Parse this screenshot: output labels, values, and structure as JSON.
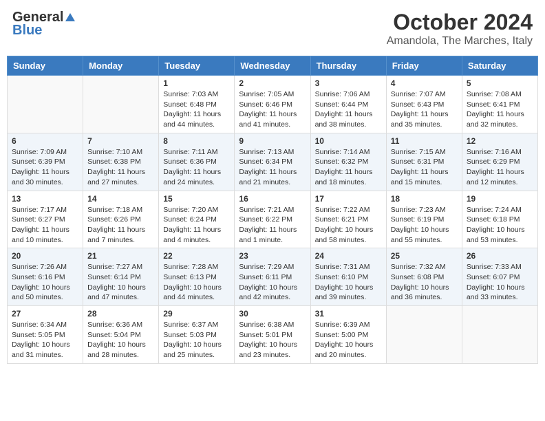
{
  "header": {
    "logo_general": "General",
    "logo_blue": "Blue",
    "month": "October 2024",
    "location": "Amandola, The Marches, Italy"
  },
  "weekdays": [
    "Sunday",
    "Monday",
    "Tuesday",
    "Wednesday",
    "Thursday",
    "Friday",
    "Saturday"
  ],
  "weeks": [
    [
      {
        "day": "",
        "sunrise": "",
        "sunset": "",
        "daylight": ""
      },
      {
        "day": "",
        "sunrise": "",
        "sunset": "",
        "daylight": ""
      },
      {
        "day": "1",
        "sunrise": "Sunrise: 7:03 AM",
        "sunset": "Sunset: 6:48 PM",
        "daylight": "Daylight: 11 hours and 44 minutes."
      },
      {
        "day": "2",
        "sunrise": "Sunrise: 7:05 AM",
        "sunset": "Sunset: 6:46 PM",
        "daylight": "Daylight: 11 hours and 41 minutes."
      },
      {
        "day": "3",
        "sunrise": "Sunrise: 7:06 AM",
        "sunset": "Sunset: 6:44 PM",
        "daylight": "Daylight: 11 hours and 38 minutes."
      },
      {
        "day": "4",
        "sunrise": "Sunrise: 7:07 AM",
        "sunset": "Sunset: 6:43 PM",
        "daylight": "Daylight: 11 hours and 35 minutes."
      },
      {
        "day": "5",
        "sunrise": "Sunrise: 7:08 AM",
        "sunset": "Sunset: 6:41 PM",
        "daylight": "Daylight: 11 hours and 32 minutes."
      }
    ],
    [
      {
        "day": "6",
        "sunrise": "Sunrise: 7:09 AM",
        "sunset": "Sunset: 6:39 PM",
        "daylight": "Daylight: 11 hours and 30 minutes."
      },
      {
        "day": "7",
        "sunrise": "Sunrise: 7:10 AM",
        "sunset": "Sunset: 6:38 PM",
        "daylight": "Daylight: 11 hours and 27 minutes."
      },
      {
        "day": "8",
        "sunrise": "Sunrise: 7:11 AM",
        "sunset": "Sunset: 6:36 PM",
        "daylight": "Daylight: 11 hours and 24 minutes."
      },
      {
        "day": "9",
        "sunrise": "Sunrise: 7:13 AM",
        "sunset": "Sunset: 6:34 PM",
        "daylight": "Daylight: 11 hours and 21 minutes."
      },
      {
        "day": "10",
        "sunrise": "Sunrise: 7:14 AM",
        "sunset": "Sunset: 6:32 PM",
        "daylight": "Daylight: 11 hours and 18 minutes."
      },
      {
        "day": "11",
        "sunrise": "Sunrise: 7:15 AM",
        "sunset": "Sunset: 6:31 PM",
        "daylight": "Daylight: 11 hours and 15 minutes."
      },
      {
        "day": "12",
        "sunrise": "Sunrise: 7:16 AM",
        "sunset": "Sunset: 6:29 PM",
        "daylight": "Daylight: 11 hours and 12 minutes."
      }
    ],
    [
      {
        "day": "13",
        "sunrise": "Sunrise: 7:17 AM",
        "sunset": "Sunset: 6:27 PM",
        "daylight": "Daylight: 11 hours and 10 minutes."
      },
      {
        "day": "14",
        "sunrise": "Sunrise: 7:18 AM",
        "sunset": "Sunset: 6:26 PM",
        "daylight": "Daylight: 11 hours and 7 minutes."
      },
      {
        "day": "15",
        "sunrise": "Sunrise: 7:20 AM",
        "sunset": "Sunset: 6:24 PM",
        "daylight": "Daylight: 11 hours and 4 minutes."
      },
      {
        "day": "16",
        "sunrise": "Sunrise: 7:21 AM",
        "sunset": "Sunset: 6:22 PM",
        "daylight": "Daylight: 11 hours and 1 minute."
      },
      {
        "day": "17",
        "sunrise": "Sunrise: 7:22 AM",
        "sunset": "Sunset: 6:21 PM",
        "daylight": "Daylight: 10 hours and 58 minutes."
      },
      {
        "day": "18",
        "sunrise": "Sunrise: 7:23 AM",
        "sunset": "Sunset: 6:19 PM",
        "daylight": "Daylight: 10 hours and 55 minutes."
      },
      {
        "day": "19",
        "sunrise": "Sunrise: 7:24 AM",
        "sunset": "Sunset: 6:18 PM",
        "daylight": "Daylight: 10 hours and 53 minutes."
      }
    ],
    [
      {
        "day": "20",
        "sunrise": "Sunrise: 7:26 AM",
        "sunset": "Sunset: 6:16 PM",
        "daylight": "Daylight: 10 hours and 50 minutes."
      },
      {
        "day": "21",
        "sunrise": "Sunrise: 7:27 AM",
        "sunset": "Sunset: 6:14 PM",
        "daylight": "Daylight: 10 hours and 47 minutes."
      },
      {
        "day": "22",
        "sunrise": "Sunrise: 7:28 AM",
        "sunset": "Sunset: 6:13 PM",
        "daylight": "Daylight: 10 hours and 44 minutes."
      },
      {
        "day": "23",
        "sunrise": "Sunrise: 7:29 AM",
        "sunset": "Sunset: 6:11 PM",
        "daylight": "Daylight: 10 hours and 42 minutes."
      },
      {
        "day": "24",
        "sunrise": "Sunrise: 7:31 AM",
        "sunset": "Sunset: 6:10 PM",
        "daylight": "Daylight: 10 hours and 39 minutes."
      },
      {
        "day": "25",
        "sunrise": "Sunrise: 7:32 AM",
        "sunset": "Sunset: 6:08 PM",
        "daylight": "Daylight: 10 hours and 36 minutes."
      },
      {
        "day": "26",
        "sunrise": "Sunrise: 7:33 AM",
        "sunset": "Sunset: 6:07 PM",
        "daylight": "Daylight: 10 hours and 33 minutes."
      }
    ],
    [
      {
        "day": "27",
        "sunrise": "Sunrise: 6:34 AM",
        "sunset": "Sunset: 5:05 PM",
        "daylight": "Daylight: 10 hours and 31 minutes."
      },
      {
        "day": "28",
        "sunrise": "Sunrise: 6:36 AM",
        "sunset": "Sunset: 5:04 PM",
        "daylight": "Daylight: 10 hours and 28 minutes."
      },
      {
        "day": "29",
        "sunrise": "Sunrise: 6:37 AM",
        "sunset": "Sunset: 5:03 PM",
        "daylight": "Daylight: 10 hours and 25 minutes."
      },
      {
        "day": "30",
        "sunrise": "Sunrise: 6:38 AM",
        "sunset": "Sunset: 5:01 PM",
        "daylight": "Daylight: 10 hours and 23 minutes."
      },
      {
        "day": "31",
        "sunrise": "Sunrise: 6:39 AM",
        "sunset": "Sunset: 5:00 PM",
        "daylight": "Daylight: 10 hours and 20 minutes."
      },
      {
        "day": "",
        "sunrise": "",
        "sunset": "",
        "daylight": ""
      },
      {
        "day": "",
        "sunrise": "",
        "sunset": "",
        "daylight": ""
      }
    ]
  ]
}
